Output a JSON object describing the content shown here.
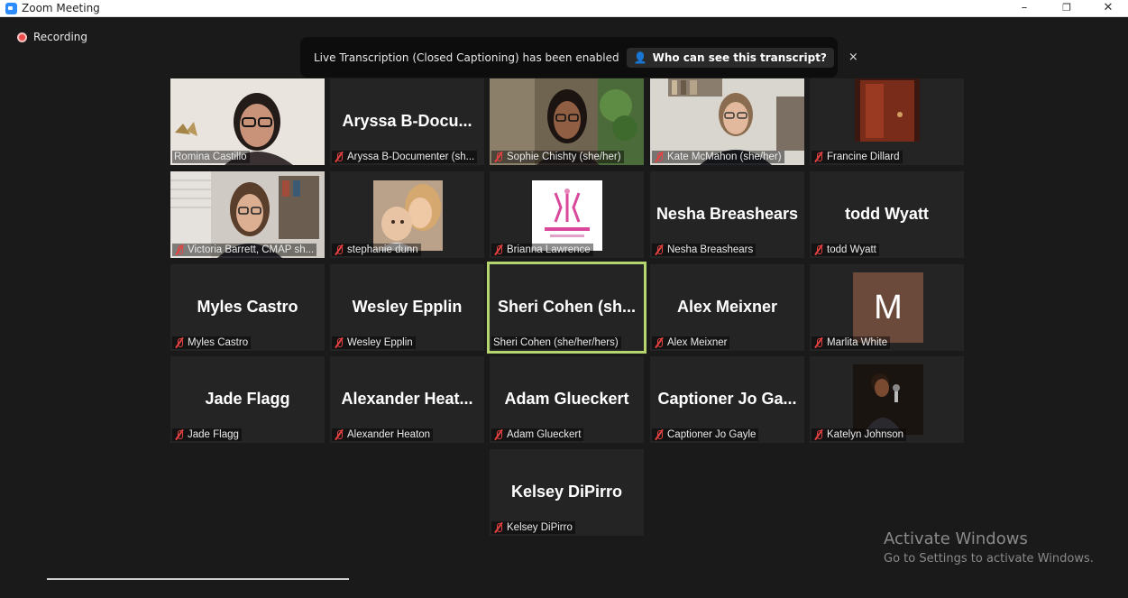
{
  "window": {
    "title": "Zoom Meeting",
    "min": "–",
    "max": "❐",
    "close": "✕"
  },
  "recording": {
    "label": "Recording"
  },
  "banner": {
    "message": "Live Transcription (Closed Captioning) has been enabled",
    "link": "Who can see this transcript?",
    "close": "×"
  },
  "participants": [
    {
      "big": "",
      "label": "Romina Castillo",
      "muted": false,
      "photo": "woman-glasses"
    },
    {
      "big": "Aryssa B-Docu...",
      "label": "Aryssa B-Documenter (sh...",
      "muted": true
    },
    {
      "big": "",
      "label": "Sophie Chishty (she/her)",
      "muted": true,
      "photo": "woman-plants"
    },
    {
      "big": "",
      "label": "Kate McMahon (she/her)",
      "muted": true,
      "photo": "woman-office"
    },
    {
      "big": "",
      "label": "Francine Dillard",
      "muted": true,
      "photo": "door"
    },
    {
      "big": "",
      "label": "Victoria Barrett, CMAP sh...",
      "muted": true,
      "photo": "woman-home"
    },
    {
      "big": "",
      "label": "stephanie dunn",
      "muted": true,
      "photo": "mother-baby"
    },
    {
      "big": "",
      "label": "Brianna Lawrence",
      "muted": true,
      "photo": "logo"
    },
    {
      "big": "Nesha Breashears",
      "label": "Nesha Breashears",
      "muted": true
    },
    {
      "big": "todd Wyatt",
      "label": "todd Wyatt",
      "muted": true
    },
    {
      "big": "Myles Castro",
      "label": "Myles Castro",
      "muted": true
    },
    {
      "big": "Wesley Epplin",
      "label": "Wesley Epplin",
      "muted": true
    },
    {
      "big": "Sheri Cohen (sh...",
      "label": "Sheri Cohen (she/her/hers)",
      "muted": false,
      "active": true
    },
    {
      "big": "Alex Meixner",
      "label": "Alex Meixner",
      "muted": true
    },
    {
      "big": "",
      "label": "Marlita White",
      "muted": true,
      "avatar": "M"
    },
    {
      "big": "Jade Flagg",
      "label": "Jade Flagg",
      "muted": true
    },
    {
      "big": "Alexander Heat...",
      "label": "Alexander Heaton",
      "muted": true
    },
    {
      "big": "Adam Glueckert",
      "label": "Adam Glueckert",
      "muted": true
    },
    {
      "big": "Captioner Jo Ga...",
      "label": "Captioner Jo Gayle",
      "muted": true
    },
    {
      "big": "",
      "label": "Katelyn Johnson",
      "muted": true,
      "photo": "singer"
    },
    {
      "big": "Kelsey DiPirro",
      "label": "Kelsey DiPirro",
      "muted": true
    }
  ],
  "watermark": {
    "line1": "Activate Windows",
    "line2": "Go to Settings to activate Windows."
  },
  "colors": {
    "active_border": "#b6d56f",
    "mute": "#e64141",
    "tile": "#242424",
    "background": "#1a1a1a"
  }
}
